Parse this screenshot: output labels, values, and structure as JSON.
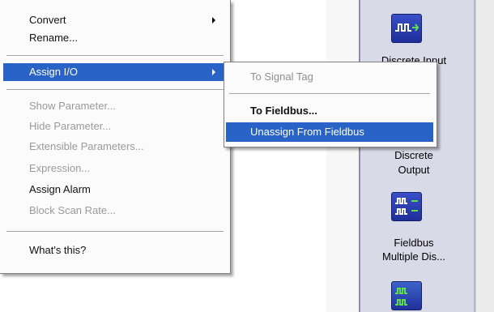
{
  "context_menu": {
    "items": [
      {
        "label": "Convert",
        "state": "enabled",
        "submenu": true
      },
      {
        "label": "Rename...",
        "state": "enabled"
      },
      {
        "label": "Assign I/O",
        "state": "selected",
        "submenu": true
      },
      {
        "label": "Show Parameter...",
        "state": "disabled"
      },
      {
        "label": "Hide Parameter...",
        "state": "disabled"
      },
      {
        "label": "Extensible Parameters...",
        "state": "disabled"
      },
      {
        "label": "Expression...",
        "state": "disabled"
      },
      {
        "label": "Assign Alarm",
        "state": "enabled"
      },
      {
        "label": "Block Scan Rate...",
        "state": "disabled"
      },
      {
        "label": "What's this?",
        "state": "enabled"
      }
    ]
  },
  "submenu": {
    "items": [
      {
        "label": "To Signal Tag",
        "state": "disabled"
      },
      {
        "label": "To Fieldbus...",
        "state": "enabled"
      },
      {
        "label": "Unassign From Fieldbus",
        "state": "selected"
      }
    ]
  },
  "palette": {
    "items": [
      {
        "label": "Discrete Input",
        "icon": "discrete-input-icon"
      },
      {
        "label_line1": "Discrete",
        "label_line2": "Output"
      },
      {
        "label_line1": "Fieldbus",
        "label_line2": "Multiple Dis...",
        "icon": "fieldbus-multiple-discrete-icon"
      },
      {
        "icon": "fieldbus-block-icon"
      }
    ]
  },
  "colors": {
    "selection": "#2a63c6",
    "menu_bg": "#fbfbfb",
    "palette_bg": "#d9dae8",
    "icon_blue": "#2a3bb0"
  }
}
